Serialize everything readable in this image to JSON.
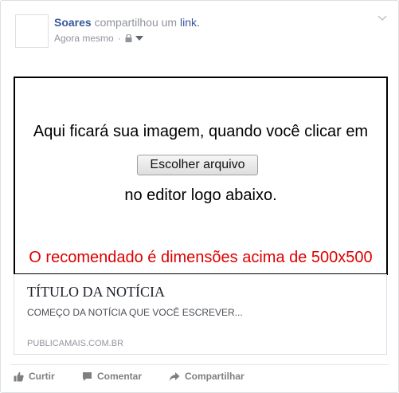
{
  "post": {
    "author": "Soares",
    "action": "compartilhou um",
    "link_word": "link.",
    "timestamp": "Agora mesmo",
    "separator": "·"
  },
  "image_placeholder": {
    "line1": "Aqui ficará sua imagem, quando você clicar em",
    "button_label": "Escolher arquivo",
    "line2": "no editor logo abaixo.",
    "recommendation": "O recomendado é dimensões acima de 500x500",
    "recommendation_color": "#e00000"
  },
  "link_preview": {
    "title": "TÍTULO DA NOTÍCIA",
    "description": "COMEÇO DA NOTÍCIA QUE VOCÊ ESCREVER...",
    "domain": "PUBLICAMAIS.COM.BR"
  },
  "actions": {
    "like": "Curtir",
    "comment": "Comentar",
    "share": "Compartilhar"
  },
  "icons": {
    "privacy": "lock-icon",
    "audience": "caret-down-icon",
    "options": "chevron-down-icon",
    "like": "thumbs-up-icon",
    "comment": "speech-bubble-icon",
    "share": "share-arrow-icon"
  },
  "colors": {
    "author": "#365899",
    "secondary_text": "#90949c",
    "border": "#dddfe2"
  }
}
